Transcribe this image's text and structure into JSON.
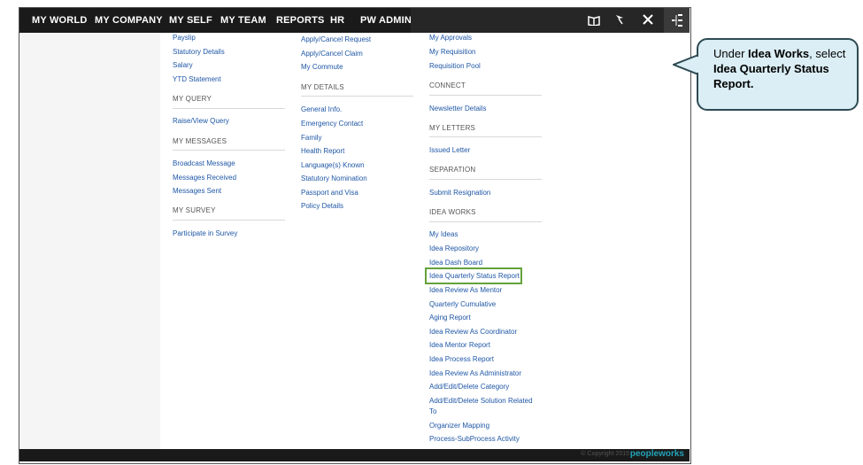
{
  "nav": {
    "items": [
      "MY WORLD",
      "MY COMPANY",
      "MY SELF",
      "MY TEAM",
      "REPORTS",
      "HR",
      "PW ADMIN"
    ],
    "icons": [
      "book-icon",
      "flag-icon",
      "tools-icon",
      "help-icon",
      "sitemap-icon"
    ]
  },
  "col1": {
    "top_links": [
      "Payslip",
      "Statutory Details",
      "Salary",
      "YTD Statement"
    ],
    "my_query": {
      "heading": "MY QUERY",
      "links": [
        "Raise/View Query"
      ]
    },
    "my_messages": {
      "heading": "MY MESSAGES",
      "links": [
        "Broadcast Message",
        "Messages Received",
        "Messages Sent"
      ]
    },
    "my_survey": {
      "heading": "MY SURVEY",
      "links": [
        "Participate in Survey"
      ]
    }
  },
  "col2": {
    "top_links": [
      "Apply/Cancel Request",
      "Apply/Cancel Claim",
      "My Commute"
    ],
    "my_details": {
      "heading": "MY DETAILS",
      "links": [
        "General Info.",
        "Emergency Contact",
        "Family",
        "Health Report",
        "Language(s) Known",
        "Statutory Nomination",
        "Passport and Visa",
        "Policy Details"
      ]
    }
  },
  "col3": {
    "top_links": [
      "My Approvals",
      "My Requisition",
      "Requisition Pool"
    ],
    "connect": {
      "heading": "CONNECT",
      "links": [
        "Newsletter Details"
      ]
    },
    "my_letters": {
      "heading": "MY LETTERS",
      "links": [
        "Issued Letter"
      ]
    },
    "separation": {
      "heading": "SEPARATION",
      "links": [
        "Submit Resignation"
      ]
    },
    "idea_works": {
      "heading": "IDEA WORKS",
      "links": [
        "My Ideas",
        "Idea Repository",
        "Idea Dash Board",
        "Idea Quarterly Status Report",
        "Idea Review As Mentor",
        "Quarterly Cumulative",
        "Aging Report",
        "Idea Review As Coordinator",
        "Idea Mentor Report",
        "Idea Process Report",
        "Idea Review As Administrator",
        "Add/Edit/Delete Category",
        "Add/Edit/Delete Solution Related",
        "To",
        "Organizer Mapping",
        "Process-SubProcess Activity"
      ]
    }
  },
  "footer": {
    "copyright": "© Copyright 2015",
    "logo": "peopleworks"
  },
  "callout": {
    "p1": "Under ",
    "b1": "Idea Works",
    "p2": ", select ",
    "b2": "Idea Quarterly Status Report."
  },
  "colors": {
    "nav_bg": "#1a1a1a",
    "link": "#1f57a6",
    "highlight": "#64a23a",
    "callout_bg": "#dbeef5"
  }
}
